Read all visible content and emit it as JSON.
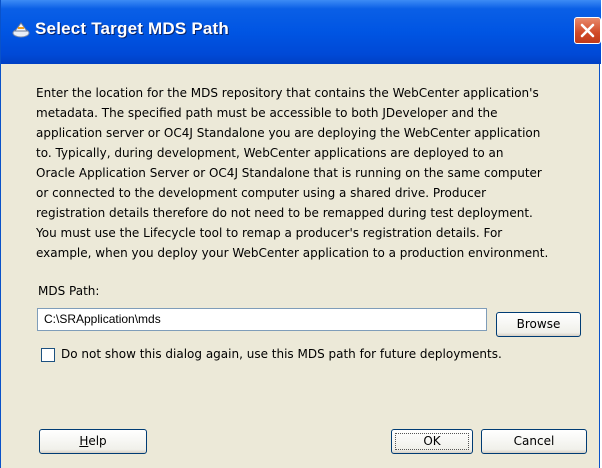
{
  "window": {
    "title": "Select Target MDS Path",
    "title_icon": "deploy-icon",
    "close_icon": "close-icon"
  },
  "description": [
    "Enter the location for the MDS repository that contains the WebCenter application's",
    "metadata. The specified path must be accessible to both JDeveloper and the",
    "application server or OC4J Standalone you are deploying the WebCenter application",
    "to. Typically, during development, WebCenter applications are deployed to an",
    "Oracle Application Server or OC4J Standalone that is running on the same computer",
    "or connected to the development computer using a shared drive. Producer",
    "registration details therefore do not need to be remapped during test deployment.",
    "You must use the Lifecycle tool to remap a producer's registration details. For",
    "example, when you deploy your WebCenter application to a production environment."
  ],
  "mds_path": {
    "label": "MDS Path:",
    "value": "C:\\SRApplication\\mds",
    "browse_label": "Browse"
  },
  "checkbox": {
    "label": "Do not show this dialog again, use this MDS path for future deployments.",
    "checked": false
  },
  "buttons": {
    "help_prefix": "",
    "help_mnemonic": "H",
    "help_rest": "elp",
    "ok_label": "OK",
    "cancel_label": "Cancel"
  },
  "colors": {
    "titlebar": "#0055e3",
    "dialog_bg": "#ece9d8",
    "close_button": "#d14a27"
  }
}
